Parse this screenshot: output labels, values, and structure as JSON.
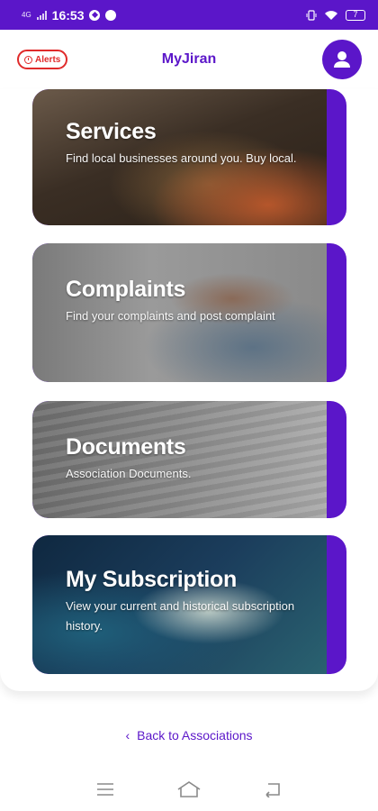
{
  "status_bar": {
    "time": "16:53",
    "network": "4G",
    "battery": "7"
  },
  "header": {
    "alerts_label": "Alerts",
    "title": "MyJiran"
  },
  "cards": [
    {
      "title": "Services",
      "description": "Find local businesses around you. Buy local."
    },
    {
      "title": "Complaints",
      "description": "Find your complaints and post complaint"
    },
    {
      "title": "Documents",
      "description": "Association Documents."
    },
    {
      "title": "My Subscription",
      "description": "View your current and historical subscription history."
    }
  ],
  "footer": {
    "back_label": "Back to Associations"
  },
  "colors": {
    "accent": "#5b16c9",
    "alert": "#e02a2a"
  }
}
